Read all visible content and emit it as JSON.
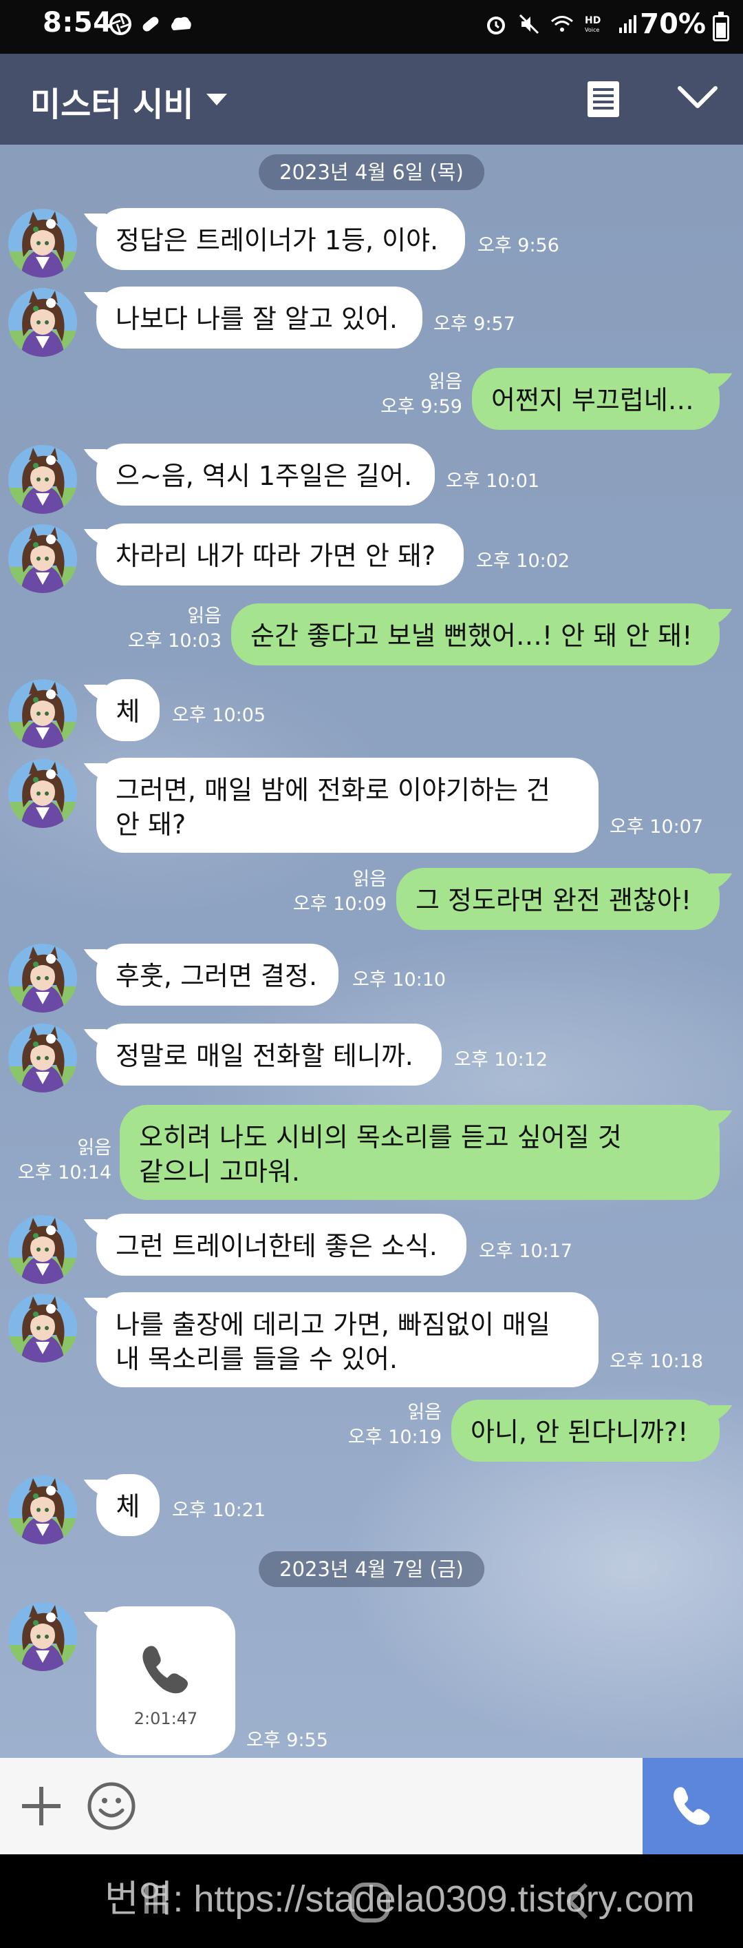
{
  "status_bar": {
    "time": "8:54",
    "battery": "70%"
  },
  "header": {
    "title": "미스터 시비"
  },
  "dates": [
    "2023년 4월 6일 (목)",
    "2023년 4월 7일 (금)"
  ],
  "messages": [
    {
      "dir": "in",
      "text": "정답은 트레이너가 1등, 이야.",
      "time": "오후 9:56"
    },
    {
      "dir": "in",
      "text": "나보다 나를 잘 알고 있어.",
      "time": "오후 9:57"
    },
    {
      "dir": "out",
      "text": "어쩐지 부끄럽네…",
      "read": "읽음",
      "time": "오후 9:59"
    },
    {
      "dir": "in",
      "text": "으~음, 역시 1주일은 길어.",
      "time": "오후 10:01"
    },
    {
      "dir": "in",
      "text": "차라리 내가 따라 가면 안 돼?",
      "time": "오후 10:02"
    },
    {
      "dir": "out",
      "text": "순간 좋다고 보낼 뻔했어…! 안 돼 안 돼!",
      "read": "읽음",
      "time": "오후 10:03"
    },
    {
      "dir": "in",
      "text": "체",
      "time": "오후 10:05"
    },
    {
      "dir": "in",
      "text_line1": "그러면, 매일 밤에 전화로 이야기하는 건",
      "text_line2": "안 돼?",
      "time": "오후 10:07"
    },
    {
      "dir": "out",
      "text": "그 정도라면 완전 괜찮아!",
      "read": "읽음",
      "time": "오후 10:09"
    },
    {
      "dir": "in",
      "text": "후훗, 그러면 결정.",
      "time": "오후 10:10"
    },
    {
      "dir": "in",
      "text": "정말로 매일 전화할 테니까.",
      "time": "오후 10:12"
    },
    {
      "dir": "out",
      "text_line1": "오히려 나도 시비의 목소리를 듣고 싶어질 것",
      "text_line2": "같으니 고마워.",
      "read": "읽음",
      "time": "오후 10:14"
    },
    {
      "dir": "in",
      "text": "그런 트레이너한테 좋은 소식.",
      "time": "오후 10:17"
    },
    {
      "dir": "in",
      "text_line1": "나를 출장에 데리고 가면, 빠짐없이 매일",
      "text_line2": "내 목소리를 들을 수 있어.",
      "time": "오후 10:18"
    },
    {
      "dir": "out",
      "text": "아니, 안 된다니까?!",
      "read": "읽음",
      "time": "오후 10:19"
    },
    {
      "dir": "in",
      "text": "체",
      "time": "오후 10:21"
    },
    {
      "dir": "in",
      "call_duration": "2:01:47",
      "time": "오후 9:55"
    }
  ],
  "watermark": "번역: https://stadela0309.tistory.com",
  "icons": {
    "avatar": "character-avatar-icon",
    "menu": "notes-icon",
    "collapse": "chevron-down-icon",
    "plus": "plus-icon",
    "emoji": "emoji-icon",
    "call": "phone-icon"
  },
  "colors": {
    "header": "#46506a",
    "chat_bg": "#8ea3c2",
    "bubble_in": "#ffffff",
    "bubble_out": "#a6e38e",
    "call_button": "#5b86dc"
  }
}
